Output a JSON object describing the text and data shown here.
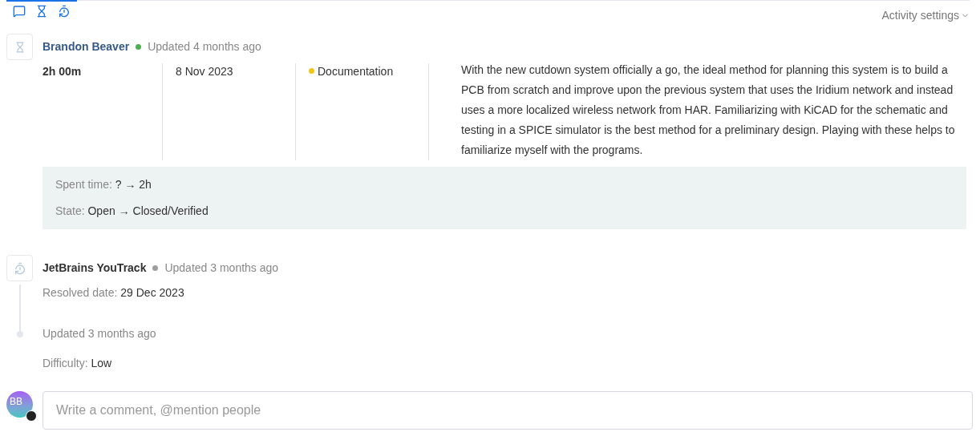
{
  "filters": [
    {
      "kind": "comment",
      "on": true
    },
    {
      "kind": "work",
      "on": true
    },
    {
      "kind": "history",
      "on": true
    }
  ],
  "activity_settings": "Activity settings",
  "entries": [
    {
      "kind": "work",
      "author": "Brandon Beaver",
      "online": true,
      "updated": "Updated 4 months ago",
      "work": {
        "duration": "2h 00m",
        "date": "8 Nov 2023",
        "type": "Documentation",
        "description": "With the new cutdown system officially a go, the ideal method for planning this system is to build a PCB from scratch and improve upon the previous system that uses the Iridium network and instead uses a more localized wireless network from HAR. Familiarizing with KiCAD for the schematic and testing in a SPICE simulator is the best method for a preliminary design. Playing with these helps to familiarize myself with the programs."
      },
      "changes": [
        {
          "label": "Spent time:",
          "from": "?",
          "arrow": "→",
          "to": "2h"
        },
        {
          "label": "State:",
          "from": "Open",
          "arrow": "→",
          "to": "Closed/Verified"
        }
      ]
    },
    {
      "kind": "history",
      "author": "JetBrains YouTrack",
      "online": false,
      "updated": "Updated 3 months ago",
      "fields": [
        {
          "label": "Resolved date:",
          "value": "29 Dec 2023"
        }
      ],
      "sub": {
        "updated": "Updated 3 months ago",
        "fields": [
          {
            "label": "Difficulty:",
            "value": "Low"
          }
        ]
      }
    }
  ],
  "comment": {
    "avatar": "BB",
    "placeholder": "Write a comment, @mention people"
  }
}
